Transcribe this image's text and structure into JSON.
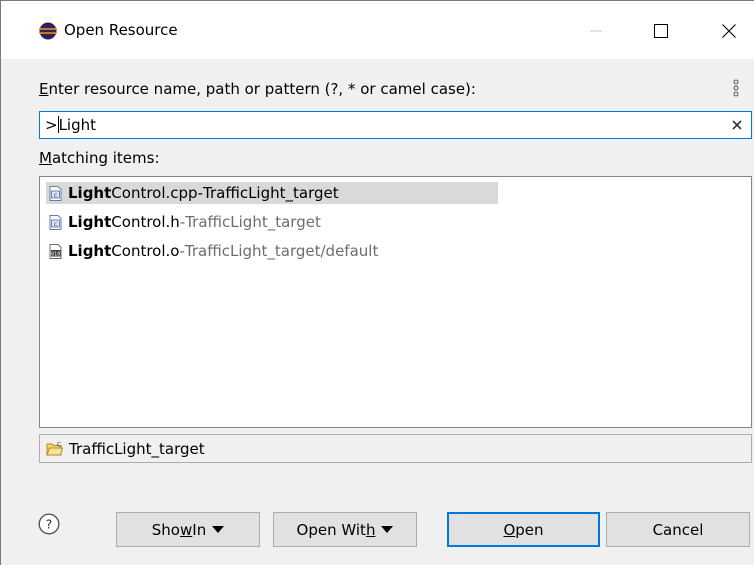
{
  "window": {
    "title": "Open Resource"
  },
  "prompt": {
    "pre": "",
    "mnemonic": "E",
    "post": "nter resource name, path or pattern (?, * or camel case):"
  },
  "search": {
    "prefix": ">",
    "value": "Light"
  },
  "matching": {
    "mnemonic": "M",
    "post": "atching items:"
  },
  "items": [
    {
      "match": "Light",
      "rest": "Control.cpp",
      "separator": " - ",
      "location": "TrafficLight_target",
      "icon": "c-source-file-icon",
      "selected": true
    },
    {
      "match": "Light",
      "rest": "Control.h",
      "separator": " - ",
      "location": "TrafficLight_target",
      "icon": "c-header-file-icon",
      "selected": false
    },
    {
      "match": "Light",
      "rest": "Control.o",
      "separator": " - ",
      "location": "TrafficLight_target/default",
      "icon": "object-file-icon",
      "selected": false
    }
  ],
  "details": {
    "project": "TrafficLight_target"
  },
  "buttons": {
    "show_in": {
      "pre": "Sho",
      "mnemonic": "w",
      "post": " In"
    },
    "open_with": {
      "pre": "Open Wit",
      "mnemonic": "h",
      "post": ""
    },
    "open": {
      "pre": "",
      "mnemonic": "O",
      "post": "pen"
    },
    "cancel": "Cancel"
  },
  "colors": {
    "focus_border": "#0078d7",
    "selection_bg": "#d9d9d9",
    "location_text": "#6d6d6d"
  }
}
